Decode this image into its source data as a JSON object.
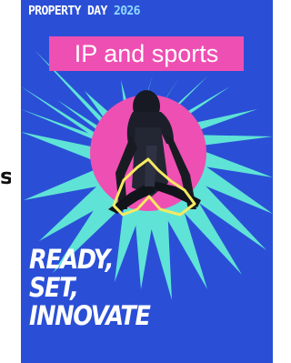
{
  "side_text": {
    "fragment": "s"
  },
  "poster": {
    "event": {
      "name": "PROPERTY DAY",
      "year": "2026"
    },
    "topic": "IP and sports",
    "slogan": {
      "line1": "READY,",
      "line2": "SET,",
      "line3": "INNOVATE"
    },
    "colors": {
      "background": "#2a4fd6",
      "accent_pink": "#ee4fb2",
      "accent_cyan": "#5fe3d6",
      "outline_yellow": "#f5ea62",
      "text": "#ffffff"
    },
    "image": {
      "subject": "athlete-in-starting-blocks"
    }
  }
}
